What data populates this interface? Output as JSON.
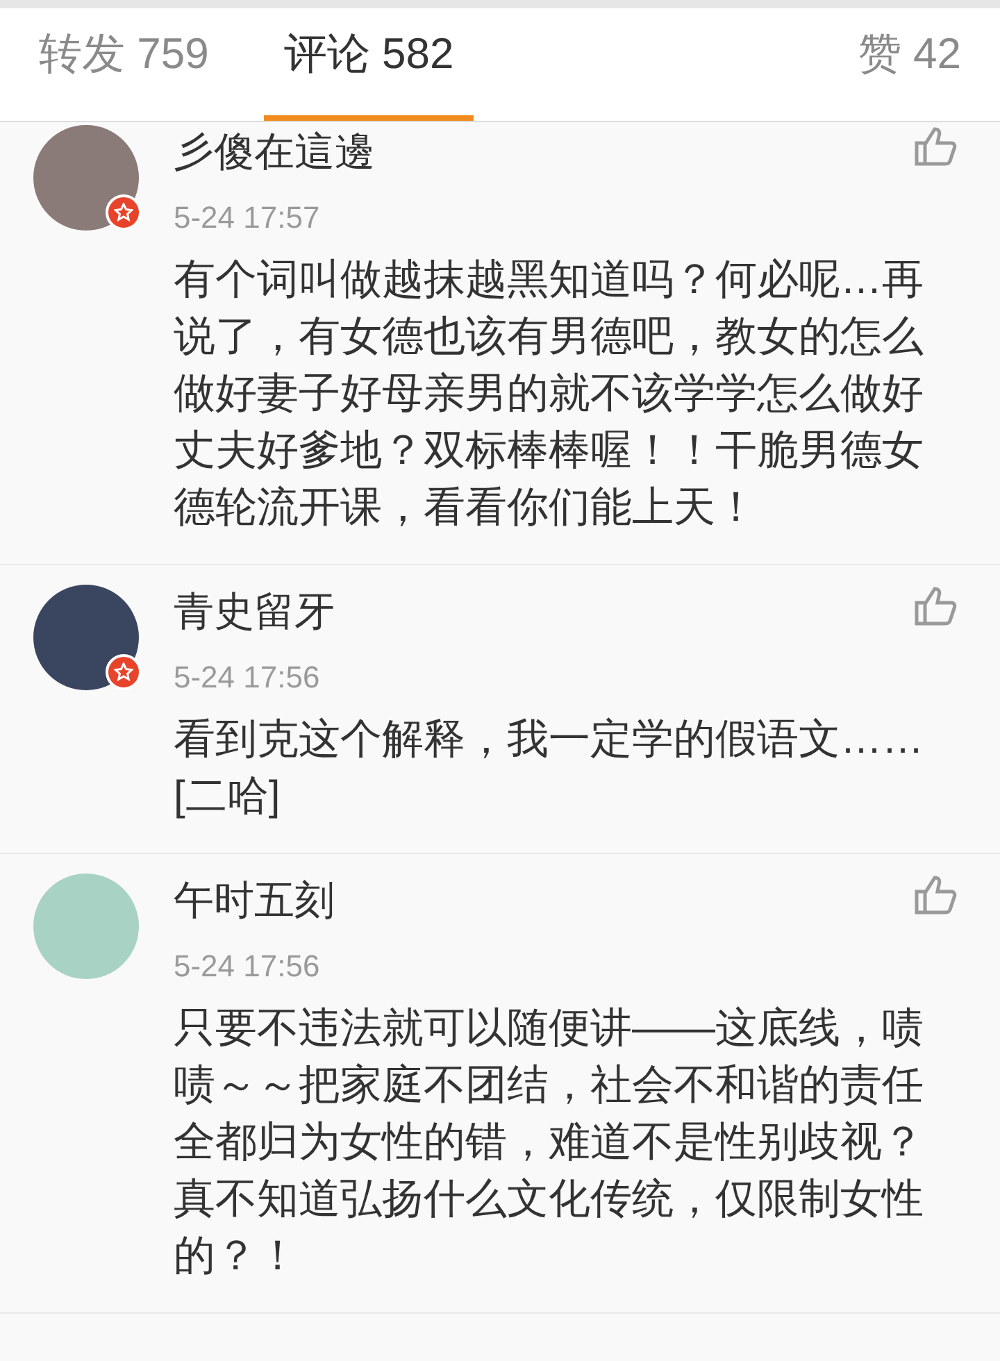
{
  "tabs": [
    {
      "label": "转发 759",
      "selected": false
    },
    {
      "label": "评论 582",
      "selected": true
    },
    {
      "label": "赞 42",
      "selected": false
    }
  ],
  "comments": [
    {
      "name": "彡傻在這邊",
      "verified": true,
      "time": "5-24 17:57",
      "text": "有个词叫做越抹越黑知道吗？何必呢…再说了，有女德也该有男德吧，教女的怎么做好妻子好母亲男的就不该学学怎么做好丈夫好爹地？双标棒棒喔！！干脆男德女德轮流开课，看看你们能上天！"
    },
    {
      "name": "青史留牙",
      "verified": true,
      "time": "5-24 17:56",
      "text": "看到克这个解释，我一定学的假语文……[二哈]"
    },
    {
      "name": "午时五刻",
      "verified": false,
      "time": "5-24 17:56",
      "text": "只要不违法就可以随便讲——这底线，啧啧～～把家庭不团结，社会不和谐的责任全都归为女性的错，难道不是性别歧视？真不知道弘扬什么文化传统，仅限制女性的？！"
    }
  ]
}
